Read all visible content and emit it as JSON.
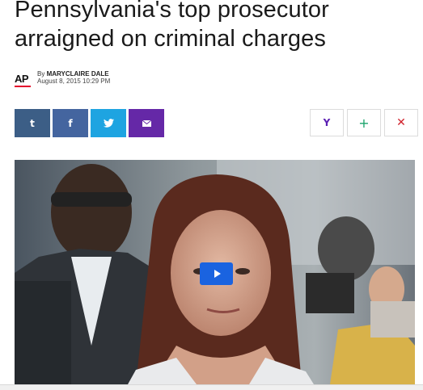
{
  "article": {
    "headline": "Pennsylvania's top prosecutor arraigned on criminal charges",
    "source_logo": "AP",
    "byline_prefix": "By",
    "author": "MARYCLAIRE DALE",
    "date": "August 8, 2015 10:29 PM"
  },
  "share": {
    "tumblr": "t",
    "facebook": "f",
    "twitter_icon": "bird-icon",
    "mail_icon": "envelope-icon"
  },
  "actions": {
    "yahoo": "Y",
    "add": "+",
    "close": "✕"
  },
  "media": {
    "play_icon": "play-icon"
  },
  "colors": {
    "tumblr": "#3c5e86",
    "facebook": "#44659f",
    "twitter": "#1ea4e1",
    "mail": "#6528a7",
    "play": "#1a63e0",
    "ap_red": "#e4002b"
  }
}
